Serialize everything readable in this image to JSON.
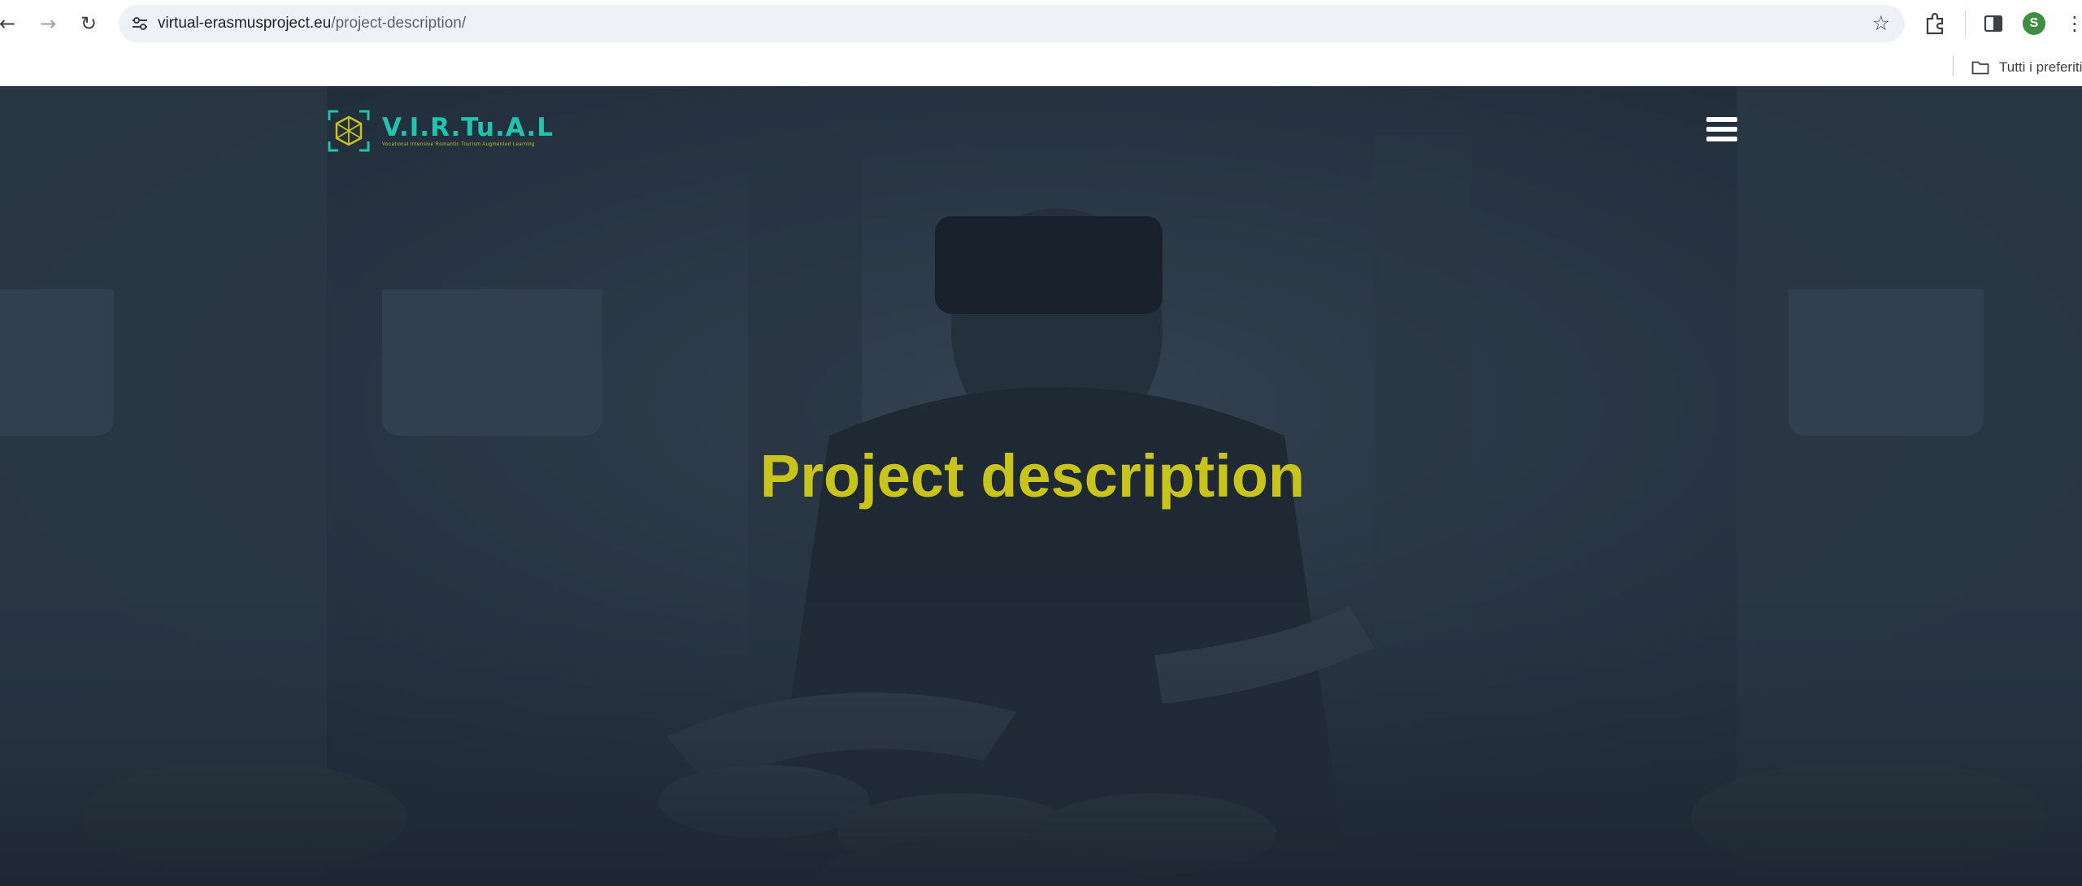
{
  "browser": {
    "url_host": "virtual-erasmusproject.eu",
    "url_path": "/project-description/",
    "profile_initial": "S",
    "bookmarks_folder_label": "Tutti i preferiti",
    "icons": [
      "back-arrow-icon",
      "forward-arrow-icon",
      "reload-icon",
      "site-settings-icon",
      "star-icon",
      "extensions-icon",
      "side-panel-icon",
      "more-vert-icon",
      "folder-icon"
    ]
  },
  "site": {
    "logo_name": "V.I.R.Tu.A.L",
    "logo_tagline": "Vocational Intensive Romantic Tourism Augmented Learning",
    "page_title": "Project description",
    "colors": {
      "title": "#c8c41c",
      "logo_teal": "#22c3ad",
      "overlay": "#2a3746"
    }
  }
}
